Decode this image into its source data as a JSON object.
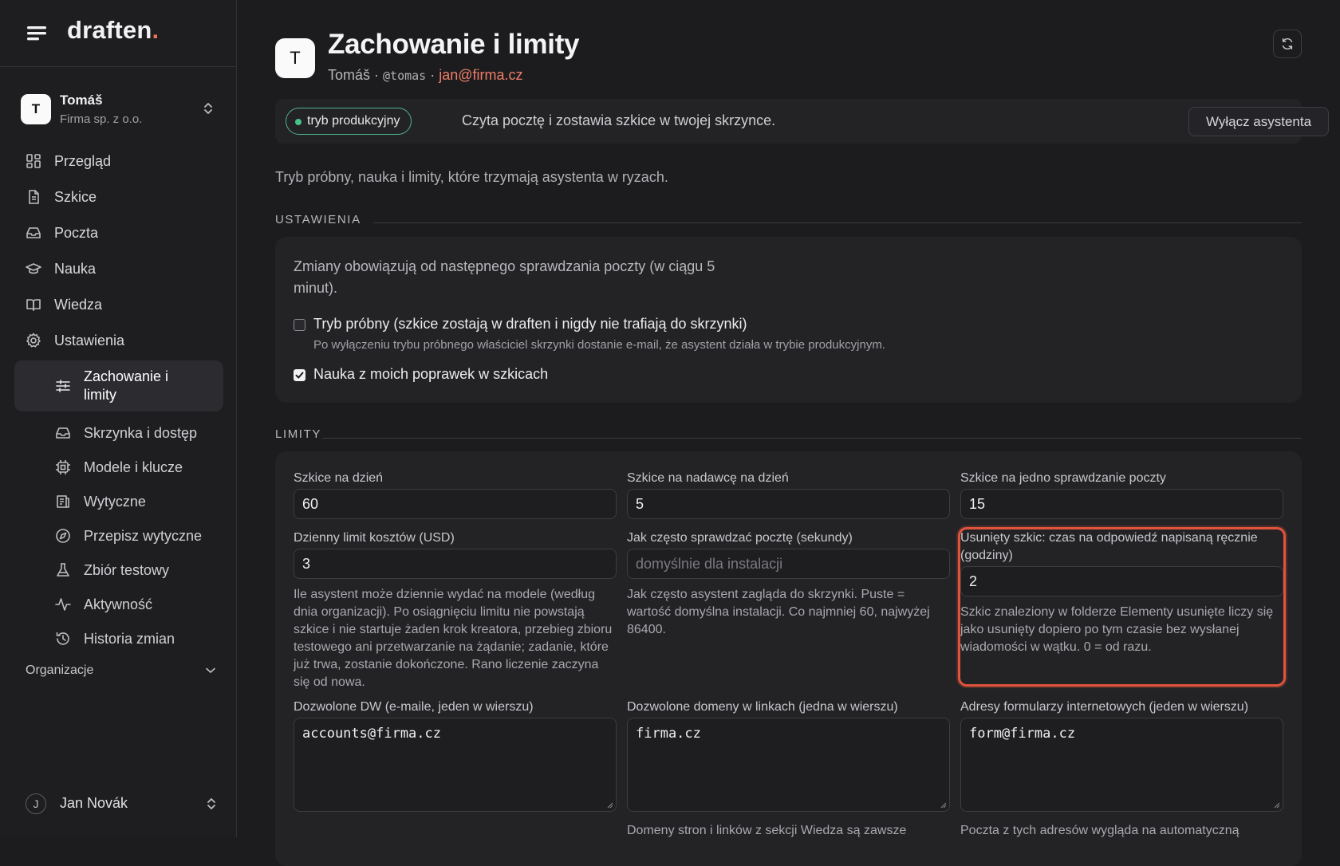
{
  "brand": {
    "name": "draften",
    "dot": "."
  },
  "account": {
    "initial": "T",
    "name": "Tomáš",
    "org": "Firma sp. z o.o."
  },
  "nav": {
    "items": [
      {
        "label": "Przegląd",
        "icon": "grid-icon"
      },
      {
        "label": "Szkice",
        "icon": "document-icon"
      },
      {
        "label": "Poczta",
        "icon": "inbox-icon"
      },
      {
        "label": "Nauka",
        "icon": "graduation-cap-icon"
      },
      {
        "label": "Wiedza",
        "icon": "book-open-icon"
      },
      {
        "label": "Ustawienia",
        "icon": "gear-icon"
      }
    ],
    "sub": [
      {
        "label": "Zachowanie i limity",
        "icon": "sliders-icon",
        "active": true
      },
      {
        "label": "Skrzynka i dostęp",
        "icon": "inbox-icon"
      },
      {
        "label": "Modele i klucze",
        "icon": "chip-icon"
      },
      {
        "label": "Wytyczne",
        "icon": "guidelines-icon"
      },
      {
        "label": "Przepisz wytyczne",
        "icon": "compass-icon"
      },
      {
        "label": "Zbiór testowy",
        "icon": "flask-icon"
      },
      {
        "label": "Aktywność",
        "icon": "activity-icon"
      },
      {
        "label": "Historia zmian",
        "icon": "history-icon"
      }
    ]
  },
  "organizations": {
    "label": "Organizacje"
  },
  "user": {
    "initial": "J",
    "name": "Jan Novák"
  },
  "header": {
    "avatar_initial": "T",
    "title": "Zachowanie i limity",
    "name": "Tomáš",
    "sep": " · ",
    "handle": "@tomas",
    "email": "jan@firma.cz"
  },
  "mode": {
    "pill": "tryb produkcyjny",
    "status_color": "#46c38a",
    "text": "Czyta pocztę i zostawia szkice w twojej skrzynce.",
    "disable_button": "Wyłącz asystenta"
  },
  "intro": "Tryb próbny, nauka i limity, które trzymają asystenta w ryzach.",
  "settings": {
    "heading": "USTAWIENIA",
    "note": "Zmiany obowiązują od następnego sprawdzania poczty (w ciągu 5 minut).",
    "trial": {
      "label": "Tryb próbny (szkice zostają w draften i nigdy nie trafiają do skrzynki)",
      "help": "Po wyłączeniu trybu próbnego właściciel skrzynki dostanie e-mail, że asystent działa w trybie produkcyjnym.",
      "checked": false
    },
    "learn": {
      "label": "Nauka z moich poprawek w szkicach",
      "checked": true
    }
  },
  "limits": {
    "heading": "LIMITY",
    "drafts_per_day": {
      "label": "Szkice na dzień",
      "value": "60"
    },
    "drafts_per_sender": {
      "label": "Szkice na nadawcę na dzień",
      "value": "5"
    },
    "drafts_per_check": {
      "label": "Szkice na jedno sprawdzanie poczty",
      "value": "15"
    },
    "cost_limit": {
      "label": "Dzienny limit kosztów (USD)",
      "value": "3",
      "help": "Ile asystent może dziennie wydać na modele (według dnia organizacji). Po osiągnięciu limitu nie powstają szkice i nie startuje żaden krok kreatora, przebieg zbioru testowego ani przetwarzanie na żądanie; zadanie, które już trwa, zostanie dokończone. Rano liczenie zaczyna się od nowa."
    },
    "poll_interval": {
      "label": "Jak często sprawdzać pocztę (sekundy)",
      "placeholder": "domyślnie dla instalacji",
      "help": "Jak często asystent zagląda do skrzynki. Puste = wartość domyślna instalacji. Co najmniej 60, najwyżej 86400."
    },
    "deleted_draft": {
      "label": "Usunięty szkic: czas na odpowiedź napisaną ręcznie (godziny)",
      "value": "2",
      "help": "Szkic znaleziony w folderze Elementy usunięte liczy się jako usunięty dopiero po tym czasie bez wysłanej wiadomości w wątku. 0 = od razu."
    },
    "allowed_cc": {
      "label": "Dozwolone DW (e-maile, jeden w wierszu)",
      "value": "accounts@firma.cz"
    },
    "allowed_domains": {
      "label": "Dozwolone domeny w linkach (jedna w wierszu)",
      "value": "firma.cz",
      "help": "Domeny stron i linków z sekcji Wiedza są zawsze"
    },
    "form_addresses": {
      "label": "Adresy formularzy internetowych (jeden w wierszu)",
      "value": "form@firma.cz",
      "help": "Poczta z tych adresów wygląda na automatyczną"
    }
  },
  "colors": {
    "accent": "#f07e68",
    "highlight": "#e0533c",
    "background": "#1c1c1e"
  }
}
